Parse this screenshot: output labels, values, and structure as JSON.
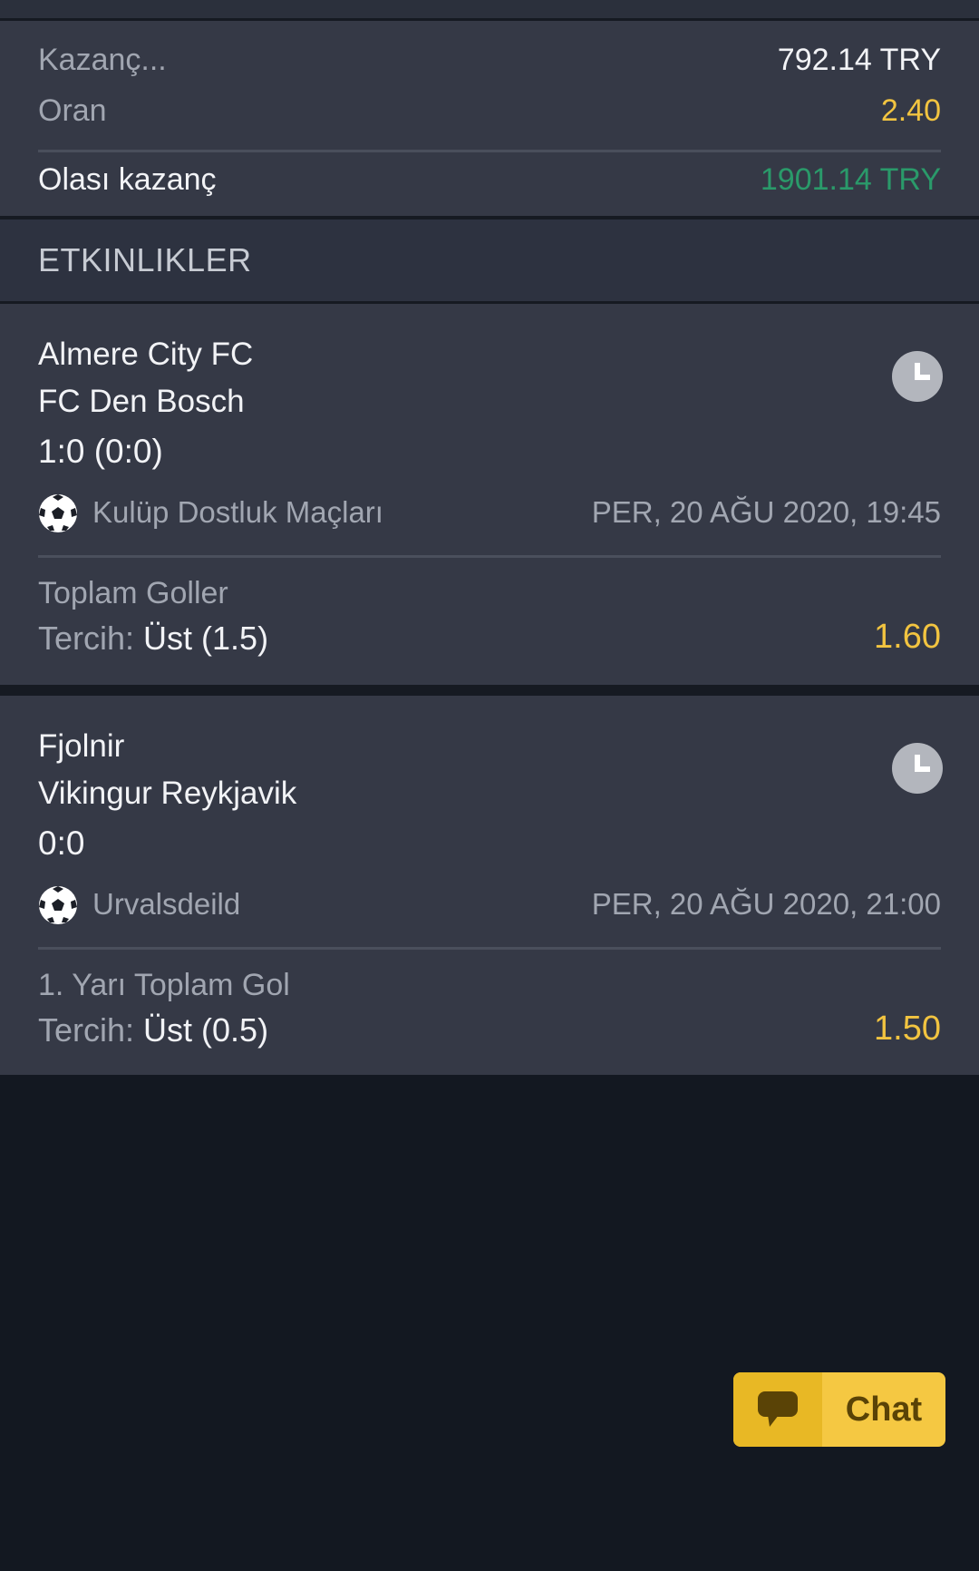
{
  "summary": {
    "stake_label": "Kazanç...",
    "stake_value": "792.14 TRY",
    "odds_label": "Oran",
    "odds_value": "2.40",
    "potential_label": "Olası kazanç",
    "potential_value": "1901.14 TRY"
  },
  "events_header": "ETKINLIKLER",
  "events": [
    {
      "home": "Almere City FC",
      "away": "FC Den Bosch",
      "score": "1:0 (0:0)",
      "league": "Kulüp Dostluk Maçları",
      "datetime": "PER, 20 AĞU 2020, 19:45",
      "market": "Toplam Goller",
      "pick_label": "Tercih:",
      "pick_value": "Üst (1.5)",
      "odd": "1.60",
      "status_icon": "clock-icon",
      "sport_icon": "soccer-ball-icon"
    },
    {
      "home": "Fjolnir",
      "away": "Vikingur Reykjavik",
      "score": "0:0",
      "league": "Urvalsdeild",
      "datetime": "PER, 20 AĞU 2020, 21:00",
      "market": "1. Yarı Toplam Gol",
      "pick_label": "Tercih:",
      "pick_value": "Üst (0.5)",
      "odd": "1.50",
      "status_icon": "clock-icon",
      "sport_icon": "soccer-ball-icon"
    }
  ],
  "chat": {
    "label": "Chat",
    "icon": "speech-bubble-icon"
  },
  "colors": {
    "background": "#131821",
    "card": "#353946",
    "accent_yellow": "#f2c440",
    "accent_green": "#2a9a6a"
  }
}
